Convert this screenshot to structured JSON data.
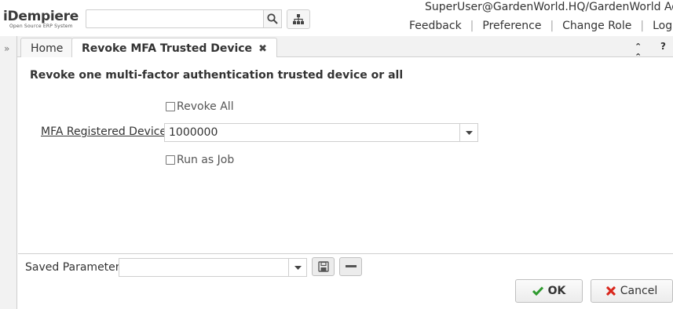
{
  "header": {
    "logo_text": "iDempiere",
    "logo_subtext": "Open Source ERP System",
    "search_value": "",
    "user": "SuperUser@GardenWorld.HQ/GardenWorld Admin",
    "links": [
      "Feedback",
      "Preference",
      "Change Role",
      "Log Out"
    ]
  },
  "tabs": [
    {
      "label": "Home"
    },
    {
      "label": "Revoke MFA Trusted Device",
      "active": true
    }
  ],
  "form": {
    "description": "Revoke one multi-factor authentication trusted device or all",
    "revoke_all_label": "Revoke All",
    "revoke_all_checked": false,
    "mfa_label": "MFA Registered Device",
    "mfa_value": "1000000",
    "run_as_job_label": "Run as Job",
    "run_as_job_checked": false
  },
  "footer": {
    "saved_params_label": "Saved Parameters",
    "saved_params_value": "",
    "ok_label": "OK",
    "cancel_label": "Cancel"
  },
  "colors": {
    "ok_check": "#2e9a2e",
    "cancel_x": "#d9261c"
  }
}
